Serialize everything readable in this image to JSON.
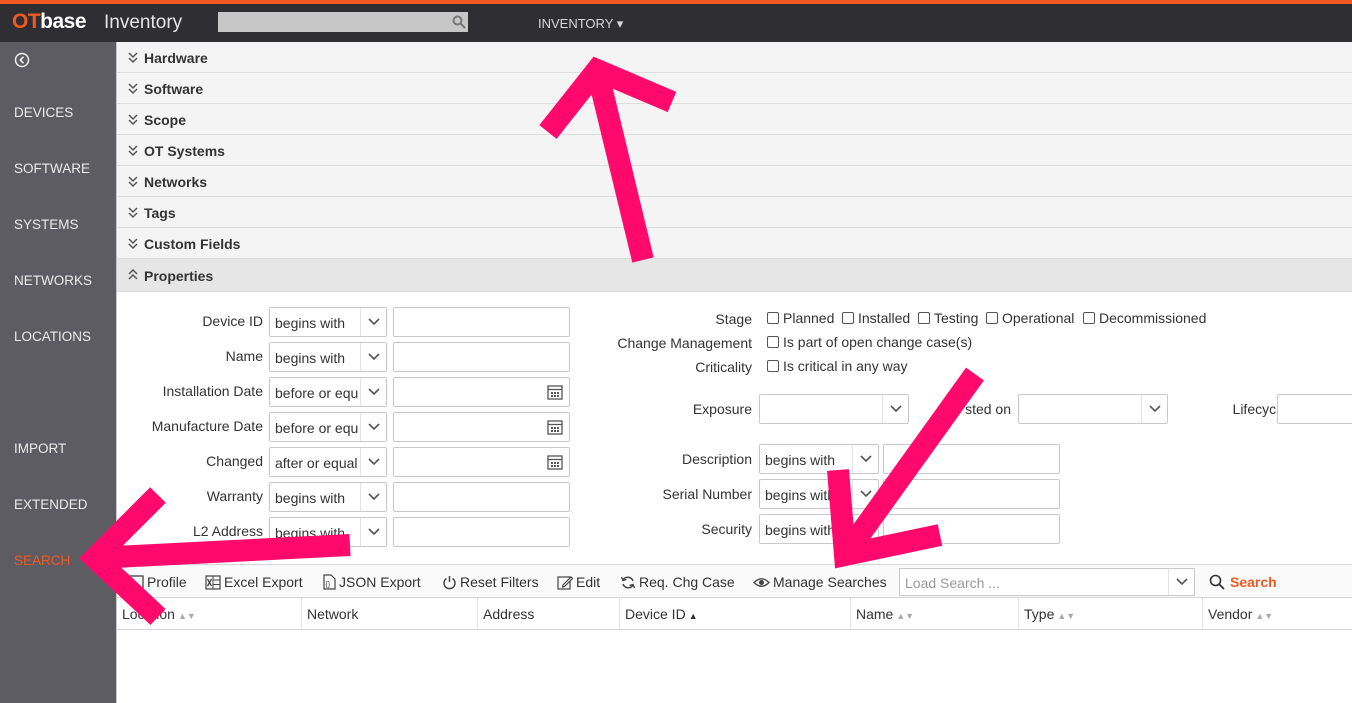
{
  "colors": {
    "accent": "#f05a22",
    "arrow": "#ff0a6c",
    "topbar": "#2e2e33",
    "sidebar": "#5c5c62"
  },
  "header": {
    "logo_ot": "OT",
    "logo_base": "base",
    "app_title": "Inventory",
    "search_placeholder": "",
    "menu_label": "INVENTORY ▾"
  },
  "sidebar": {
    "back_icon": "circle-chevron-left-icon",
    "items": [
      {
        "label": "DEVICES"
      },
      {
        "label": "SOFTWARE"
      },
      {
        "label": "SYSTEMS"
      },
      {
        "label": "NETWORKS"
      },
      {
        "label": "LOCATIONS"
      },
      {
        "label": "IMPORT"
      },
      {
        "label": "EXTENDED"
      },
      {
        "label": "SEARCH",
        "active": true
      }
    ]
  },
  "accordion": [
    {
      "label": "Hardware",
      "expanded": false
    },
    {
      "label": "Software",
      "expanded": false
    },
    {
      "label": "Scope",
      "expanded": false
    },
    {
      "label": "OT Systems",
      "expanded": false
    },
    {
      "label": "Networks",
      "expanded": false
    },
    {
      "label": "Tags",
      "expanded": false
    },
    {
      "label": "Custom Fields",
      "expanded": false
    },
    {
      "label": "Properties",
      "expanded": true
    }
  ],
  "properties": {
    "left_filters": [
      {
        "label": "Device ID",
        "operator": "begins with",
        "value": ""
      },
      {
        "label": "Name",
        "operator": "begins with",
        "value": ""
      },
      {
        "label": "Installation Date",
        "operator": "before or equ",
        "value": ""
      },
      {
        "label": "Manufacture Date",
        "operator": "before or equ",
        "value": ""
      },
      {
        "label": "Changed",
        "operator": "after or equal",
        "value": ""
      },
      {
        "label": "Warranty",
        "operator": "begins with",
        "value": ""
      },
      {
        "label": "L2 Address",
        "operator": "begins with",
        "value": ""
      }
    ],
    "stage": {
      "label": "Stage",
      "options": [
        "Planned",
        "Installed",
        "Testing",
        "Operational",
        "Decommissioned"
      ]
    },
    "change_management": {
      "label": "Change Management",
      "option": "Is part of open change case(s)"
    },
    "criticality": {
      "label": "Criticality",
      "option": "Is critical in any way"
    },
    "exposure": {
      "label": "Exposure",
      "value": ""
    },
    "listed_on": {
      "label": "sted on",
      "value": ""
    },
    "lifecycle": {
      "label": "Lifecycle",
      "value": ""
    },
    "right_filters": [
      {
        "label": "Description",
        "operator": "begins with",
        "value": ""
      },
      {
        "label": "Serial Number",
        "operator": "begins with",
        "value": ""
      },
      {
        "label": "Security",
        "operator": "begins with",
        "value": ""
      }
    ]
  },
  "toolbar": {
    "profile": "Profile",
    "excel_export": "Excel Export",
    "json_export": "JSON Export",
    "reset_filters": "Reset Filters",
    "edit": "Edit",
    "req_chg_case": "Req. Chg Case",
    "manage_searches": "Manage Searches",
    "load_search_placeholder": "Load Search ...",
    "search": "Search"
  },
  "table": {
    "columns": [
      {
        "label": "Location",
        "sort": "none"
      },
      {
        "label": "Network",
        "sort": null
      },
      {
        "label": "Address",
        "sort": null
      },
      {
        "label": "Device ID",
        "sort": "asc"
      },
      {
        "label": "Name",
        "sort": "none"
      },
      {
        "label": "Type",
        "sort": "none"
      },
      {
        "label": "Vendor",
        "sort": "none"
      }
    ],
    "rows": []
  }
}
